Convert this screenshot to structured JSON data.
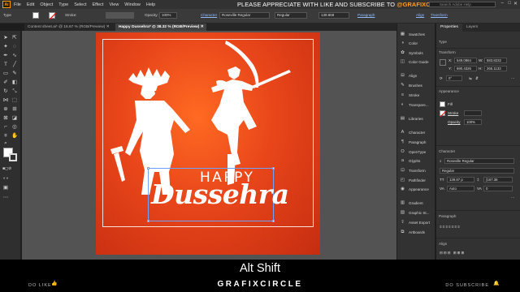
{
  "menubar": {
    "logo": "Ai",
    "items": [
      "File",
      "Edit",
      "Object",
      "Type",
      "Select",
      "Effect",
      "View",
      "Window",
      "Help"
    ],
    "promo_prefix": "PLEASE APPRECIATE WITH LIKE AND SUBSCRIBE TO",
    "promo_brand": "@GRAFIXCIRCLE",
    "search_placeholder": "Search Adobe Help"
  },
  "controlbar": {
    "type_label": "Type",
    "stroke_label": "Stroke:",
    "opacity_label": "Opacity:",
    "opacity_value": "100%",
    "character_label": "Character",
    "font_family": "Roseville Regular",
    "font_style": "Regular",
    "font_size": "139.869",
    "paragraph_label": "Paragraph",
    "align_label": "Align",
    "transform_label": "Transform"
  },
  "tabs": [
    {
      "label": "Content sheet.ai* @ 16.67 % (RGB/Preview)"
    },
    {
      "label": "Happy Dussehra* @ 38.32 % (RGB/Preview)"
    }
  ],
  "artwork": {
    "line1": "HAPPY",
    "line2": "Dussehra"
  },
  "dock": {
    "items": [
      "Swatches",
      "Color",
      "Symbols",
      "Color Guide",
      "Align",
      "Brushes",
      "Stroke",
      "Transpare...",
      "Libraries",
      "Character",
      "Paragraph",
      "OpenType",
      "Glyphs",
      "Transform",
      "Pathfinder",
      "Appearance",
      "Gradient",
      "Graphic St...",
      "Asset Export",
      "Artboards"
    ]
  },
  "properties": {
    "tabs": [
      "Properties",
      "Layers"
    ],
    "type_section": "Type",
    "transform_section": "Transform",
    "x_label": "X:",
    "x_value": "549.0864",
    "y_label": "Y:",
    "y_value": "690.4326",
    "w_label": "W:",
    "w_value": "583.8232",
    "h_label": "H:",
    "h_value": "265.1133",
    "rotate_value": "0°",
    "appearance_section": "Appearance",
    "fill_label": "Fill",
    "stroke_label": "Stroke",
    "opacity_label": "Opacity",
    "opacity_value": "100%",
    "character_section": "Character",
    "font_family": "Roseville Regular",
    "font_style": "Regular",
    "font_size": "139.87 p",
    "leading": "(167.36",
    "tracking": "Auto",
    "kerning": "0",
    "paragraph_section": "Paragraph",
    "align_section": "Align"
  },
  "footer": {
    "caption": "Alt Shift",
    "do_like": "DO LIKE",
    "brand": "GRAFIXCIRCLE",
    "do_subscribe": "DO SUBSCRIBE"
  },
  "colors": {
    "artboard": "#e8451a",
    "accent": "#ff9a1e"
  }
}
